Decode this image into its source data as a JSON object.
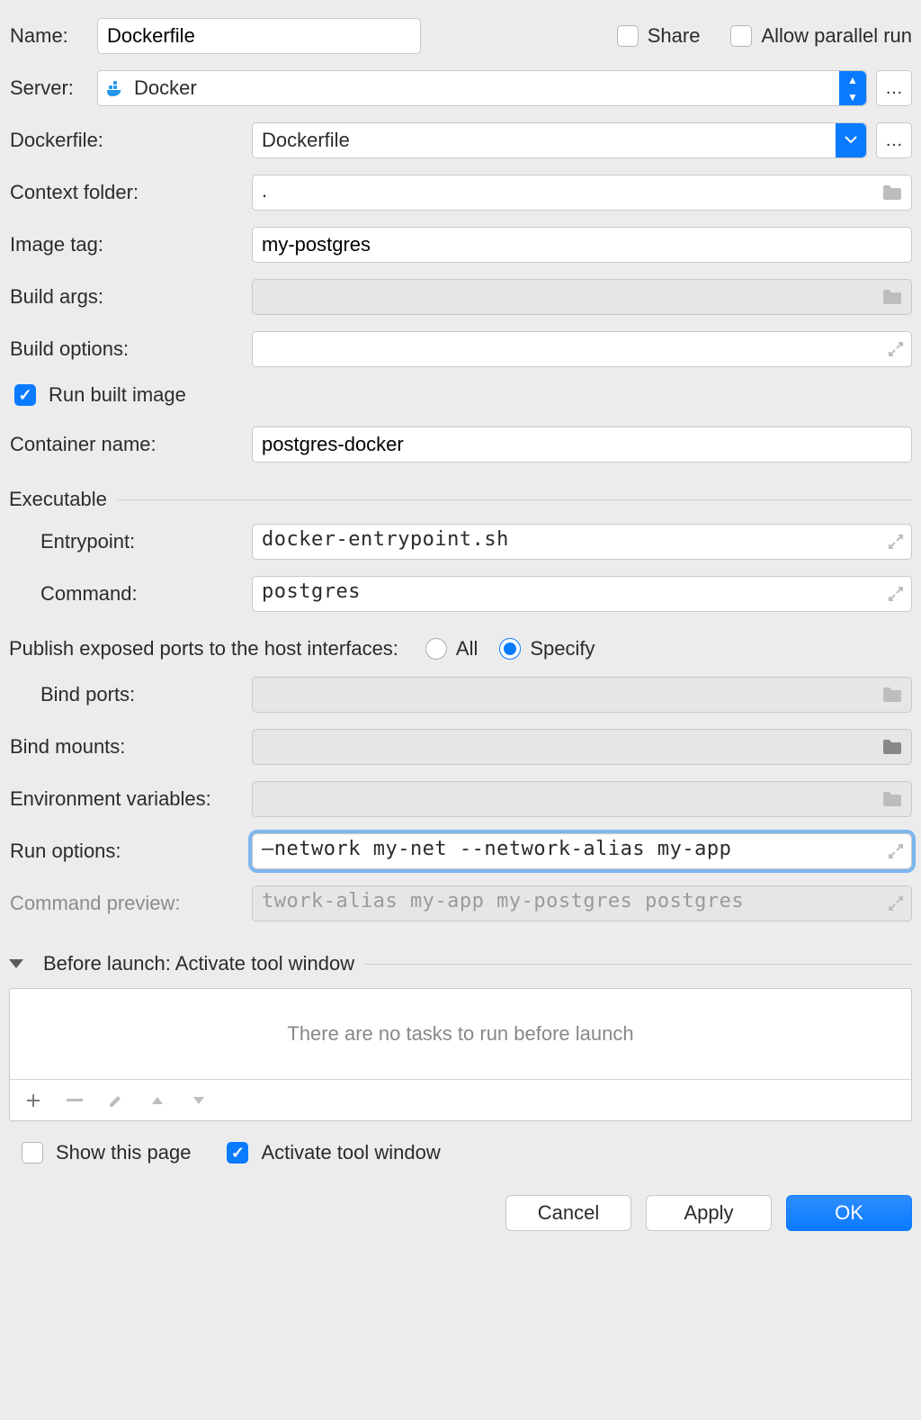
{
  "labels": {
    "name": "Name:",
    "server": "Server:",
    "dockerfile": "Dockerfile:",
    "context_folder": "Context folder:",
    "image_tag": "Image tag:",
    "build_args": "Build args:",
    "build_options": "Build options:",
    "run_built_image": "Run built image",
    "container_name": "Container name:",
    "executable": "Executable",
    "entrypoint": "Entrypoint:",
    "command": "Command:",
    "publish_ports": "Publish exposed ports to the host interfaces:",
    "all": "All",
    "specify": "Specify",
    "bind_ports": "Bind ports:",
    "bind_mounts": "Bind mounts:",
    "env_vars": "Environment variables:",
    "run_options": "Run options:",
    "command_preview": "Command preview:",
    "before_launch": "Before launch: Activate tool window",
    "no_tasks": "There are no tasks to run before launch",
    "show_this_page": "Show this page",
    "activate_tool_window": "Activate tool window",
    "share": "Share",
    "allow_parallel_run": "Allow parallel run"
  },
  "values": {
    "name": "Dockerfile",
    "server": "Docker",
    "dockerfile": "Dockerfile",
    "context_folder": ".",
    "image_tag": "my-postgres",
    "build_args": "",
    "build_options": "",
    "container_name": "postgres-docker",
    "entrypoint": "docker-entrypoint.sh",
    "command": "postgres",
    "bind_ports": "",
    "bind_mounts": "",
    "env_vars": "",
    "run_options": "–network my-net --network-alias my-app",
    "command_preview": "twork-alias my-app my-postgres postgres"
  },
  "checks": {
    "share": false,
    "allow_parallel_run": false,
    "run_built_image": true,
    "show_this_page": false,
    "activate_tool_window": true
  },
  "radios": {
    "publish": "specify"
  },
  "buttons": {
    "cancel": "Cancel",
    "apply": "Apply",
    "ok": "OK",
    "ellipsis": "…"
  }
}
